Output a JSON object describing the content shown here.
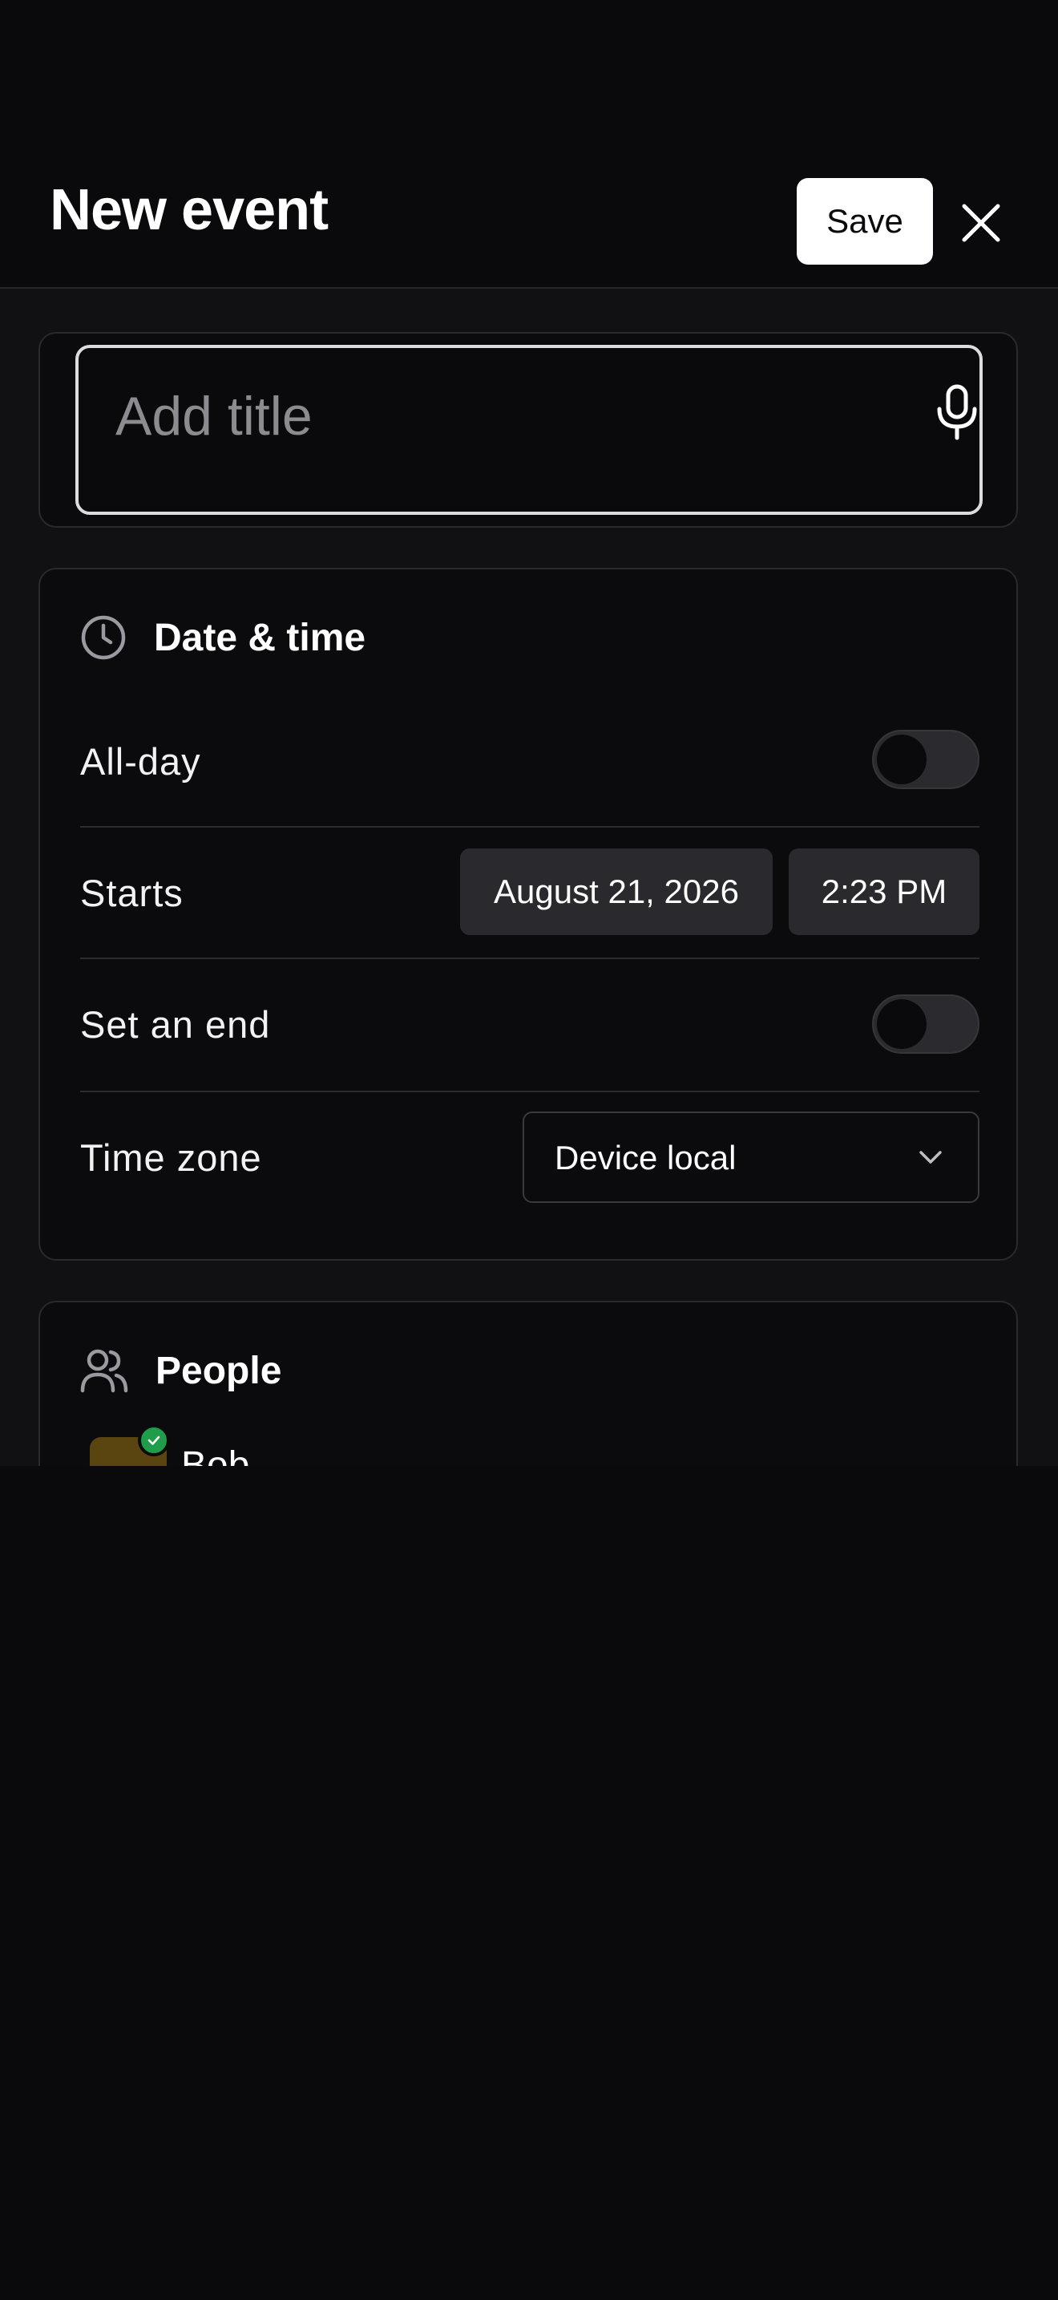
{
  "header": {
    "title": "New event",
    "save_label": "Save"
  },
  "title_field": {
    "placeholder": "Add title",
    "value": ""
  },
  "date_time": {
    "heading": "Date & time",
    "all_day": {
      "label": "All-day",
      "on": false
    },
    "starts": {
      "label": "Starts",
      "date": "August 21, 2026",
      "time": "2:23 PM"
    },
    "set_end": {
      "label": "Set an end",
      "on": false
    },
    "time_zone": {
      "label": "Time zone",
      "value": "Device local"
    }
  },
  "people": {
    "heading": "People",
    "list": [
      {
        "name": "Bob",
        "status": "accepted"
      }
    ]
  },
  "colors": {
    "background": "#0a0a0c",
    "accent_green": "#1f9d4a",
    "avatar": "#5a4410"
  },
  "icons": [
    "close-icon",
    "mic-icon",
    "clock-icon",
    "people-icon",
    "chevron-down-icon",
    "check-icon"
  ]
}
